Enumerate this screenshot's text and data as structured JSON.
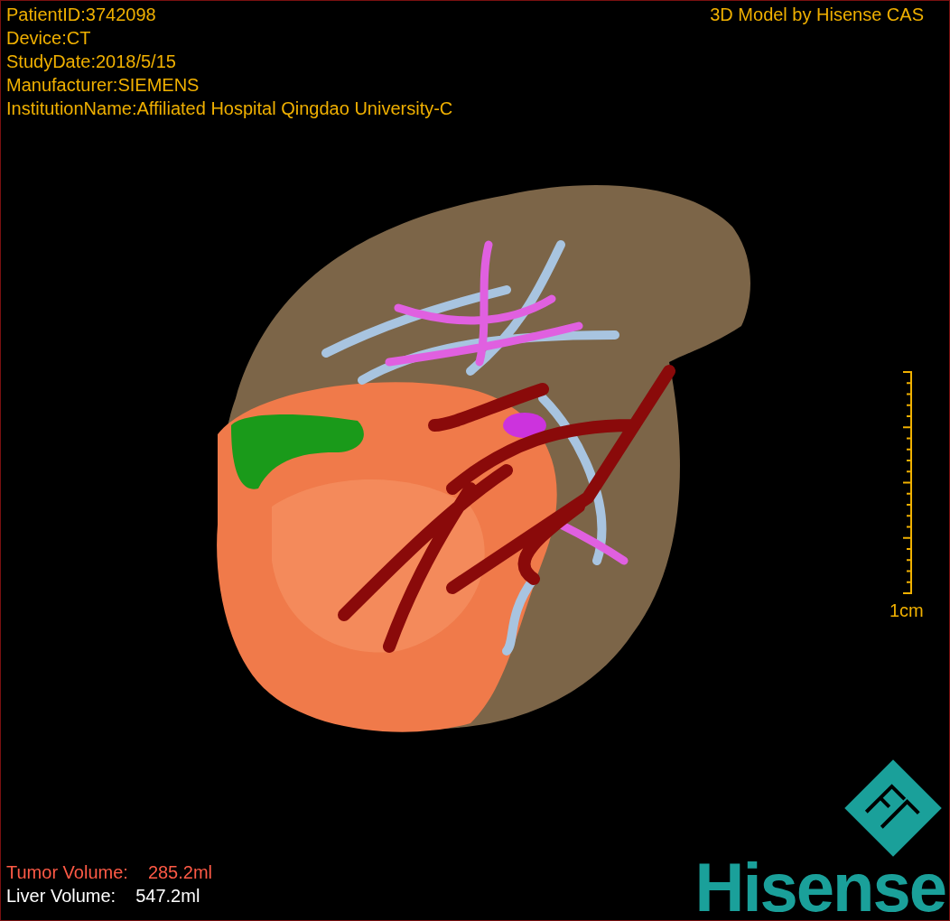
{
  "info_lines": [
    "PatientID:3742098",
    "Device:CT",
    "StudyDate:2018/5/15",
    "Manufacturer:SIEMENS",
    "InstitutionName:Affiliated Hospital Qingdao University-C"
  ],
  "title": "3D Model by Hisense CAS",
  "scale_bar": {
    "label": "1cm"
  },
  "volumes": [
    {
      "label": "Tumor Volume:",
      "value": "285.2ml",
      "color": "#ff5a46"
    },
    {
      "label": "Liver Volume:",
      "value": "547.2ml",
      "color": "#ffffff"
    }
  ],
  "logo": {
    "text": "Hisense"
  }
}
